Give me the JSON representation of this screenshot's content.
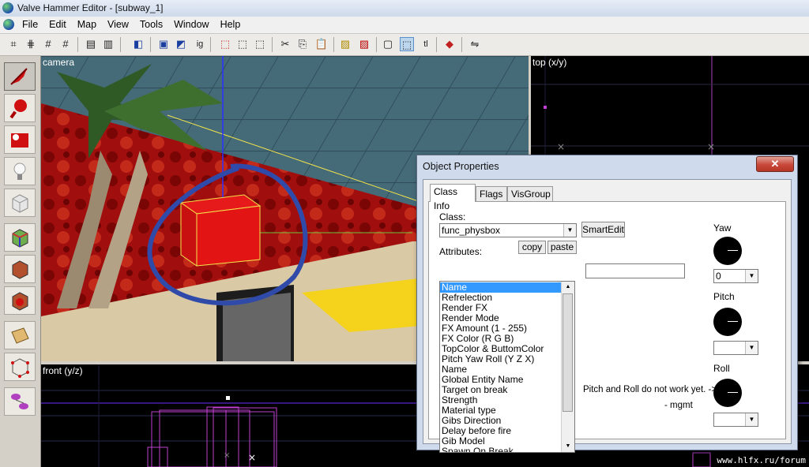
{
  "window": {
    "title": "Valve Hammer Editor - [subway_1]"
  },
  "menu": {
    "items": [
      "File",
      "Edit",
      "Map",
      "View",
      "Tools",
      "Window",
      "Help"
    ]
  },
  "views": {
    "camera_label": "camera",
    "top_label": "top (x/y)",
    "front_label": "front (y/z)",
    "watermark": "www.hlfx.ru/forum"
  },
  "dialog": {
    "title": "Object Properties",
    "close_label": "✕",
    "tabs": [
      "Class Info",
      "Flags",
      "VisGroup"
    ],
    "class_label": "Class:",
    "class_value": "func_physbox",
    "smartedit_label": "SmartEdit",
    "attributes_label": "Attributes:",
    "copy_label": "copy",
    "paste_label": "paste",
    "attributes": [
      "Name",
      "Refrelection",
      "Render FX",
      "Render Mode",
      "FX Amount (1 - 255)",
      "FX Color (R G B)",
      "TopColor & ButtomColor",
      "Pitch Yaw Roll (Y Z X)",
      "Name",
      "Global Entity Name",
      "Target on break",
      "Strength",
      "Material type",
      "Gibs Direction",
      "Delay before fire",
      "Gib Model",
      "Spawn On Break"
    ],
    "selected_attribute": "Name",
    "value": "",
    "yaw_label": "Yaw",
    "yaw_value": "0",
    "pitch_label": "Pitch",
    "pitch_value": "",
    "roll_label": "Roll",
    "roll_value": "",
    "note": "Pitch and Roll do not work yet. ->",
    "note_author": "- mgmt"
  }
}
